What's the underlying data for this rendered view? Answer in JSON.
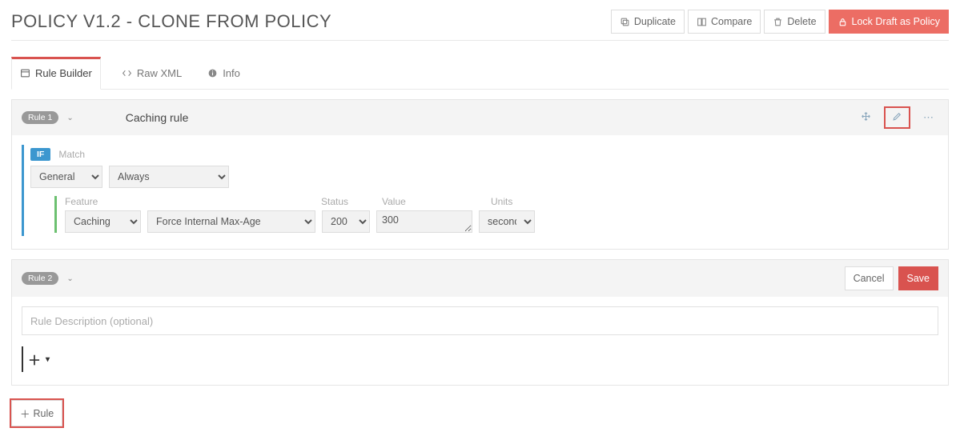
{
  "header": {
    "title": "POLICY V1.2 - CLONE FROM POLICY",
    "actions": {
      "duplicate": "Duplicate",
      "compare": "Compare",
      "delete": "Delete",
      "lock": "Lock Draft as Policy"
    }
  },
  "tabs": {
    "rule_builder": "Rule Builder",
    "raw_xml": "Raw XML",
    "info": "Info"
  },
  "rule1": {
    "pill": "Rule 1",
    "name": "Caching rule",
    "if_label": "IF",
    "match_label": "Match",
    "match_category": "General",
    "match_condition": "Always",
    "feature_label": "Feature",
    "status_label": "Status",
    "value_label": "Value",
    "units_label": "Units",
    "feature_category": "Caching",
    "feature_name": "Force Internal Max-Age",
    "status": "200",
    "value": "300",
    "units": "seconds"
  },
  "rule2": {
    "pill": "Rule 2",
    "cancel": "Cancel",
    "save": "Save",
    "desc_placeholder": "Rule Description (optional)"
  },
  "footer": {
    "add_rule": "Rule"
  }
}
